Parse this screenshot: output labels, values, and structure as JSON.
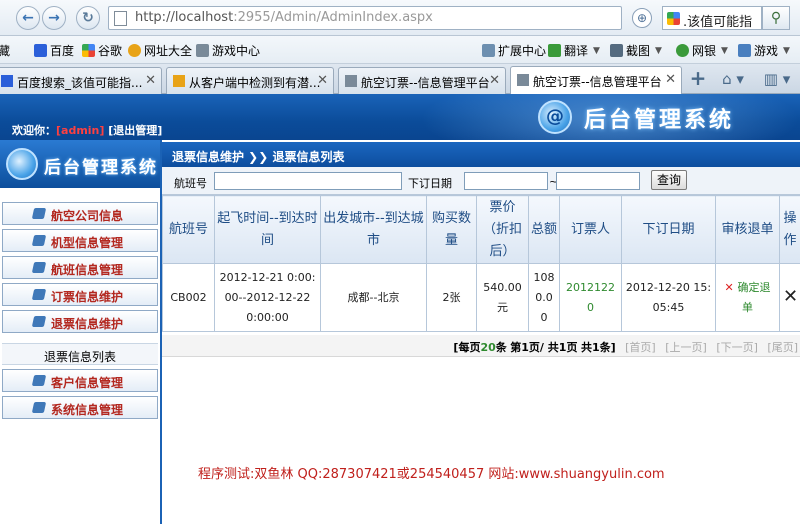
{
  "browser": {
    "url_host": "http://localhost",
    "url_rest": ":2955/Admin/AdminIndex.aspx",
    "search_text": ".该值可能指",
    "bookmarks": [
      {
        "label": "藏",
        "arrow": false
      },
      {
        "label": "百度",
        "arrow": false
      },
      {
        "label": "谷歌",
        "arrow": false
      },
      {
        "label": "网址大全",
        "arrow": false
      },
      {
        "label": "游戏中心",
        "arrow": false
      },
      {
        "label": "扩展中心",
        "arrow": false
      },
      {
        "label": "翻译",
        "arrow": true
      },
      {
        "label": "截图",
        "arrow": true
      },
      {
        "label": "网银",
        "arrow": true
      },
      {
        "label": "游戏",
        "arrow": true
      }
    ],
    "tabs": [
      {
        "label": "百度搜索_该值可能指..."
      },
      {
        "label": "从客户端中检测到有潜..."
      },
      {
        "label": "航空订票--信息管理平台"
      },
      {
        "label": "航空订票--信息管理平台"
      }
    ]
  },
  "header": {
    "welcome_prefix": "欢迎你：",
    "user": "[admin]",
    "logout": "[退出管理]",
    "title": "后台管理系统"
  },
  "sidebar": {
    "banner_title": "后台管理系统",
    "items": [
      {
        "label": "航空公司信息"
      },
      {
        "label": "机型信息管理"
      },
      {
        "label": "航班信息管理"
      },
      {
        "label": "订票信息维护"
      },
      {
        "label": "退票信息维护"
      }
    ],
    "sub_label": "退票信息列表",
    "items2": [
      {
        "label": "客户信息管理"
      },
      {
        "label": "系统信息管理"
      }
    ]
  },
  "content": {
    "breadcrumb": "退票信息维护 ❯❯ 退票信息列表",
    "search": {
      "flight_label": "航班号",
      "date_label": "下订日期",
      "tilde": "~",
      "query_button": "查询"
    },
    "table": {
      "headers": [
        "航班号",
        "起飞时间--到达时间",
        "出发城市--到达城市",
        "购买数量",
        "票价（折扣后）",
        "总额",
        "订票人",
        "下订日期",
        "审核退单",
        "操作"
      ],
      "rows": [
        {
          "flight": "CB002",
          "time": "2012-12-21 0:00:00--2012-12-22 0:00:00",
          "cities": "成都--北京",
          "qty": "2张",
          "price": "540.00元",
          "total": "1080.00",
          "booker": "20121220",
          "order_date": "2012-12-20 15:05:45",
          "audit": "确定退单",
          "op": "✕"
        }
      ]
    },
    "pager": {
      "per_page_a": "[每页",
      "per_page_n": "20",
      "per_page_b": "条",
      "page_a": "第",
      "page_n": "1",
      "page_b": "页/ 共",
      "total_pages": "1",
      "page_c": "页",
      "count_a": "共",
      "count_n": "1",
      "count_b": "条]",
      "first": "[首页]",
      "prev": "[上一页]",
      "next": "[下一页]",
      "last": "[尾页]"
    },
    "footer": "程序测试:双鱼林  QQ:287307421或254540457 网站:www.shuangyulin.com"
  },
  "colors": {
    "brand_blue": "#0d4e9e",
    "menu_red": "#b3271f",
    "green": "#2f8a2f",
    "footer_red": "#c0201c"
  }
}
